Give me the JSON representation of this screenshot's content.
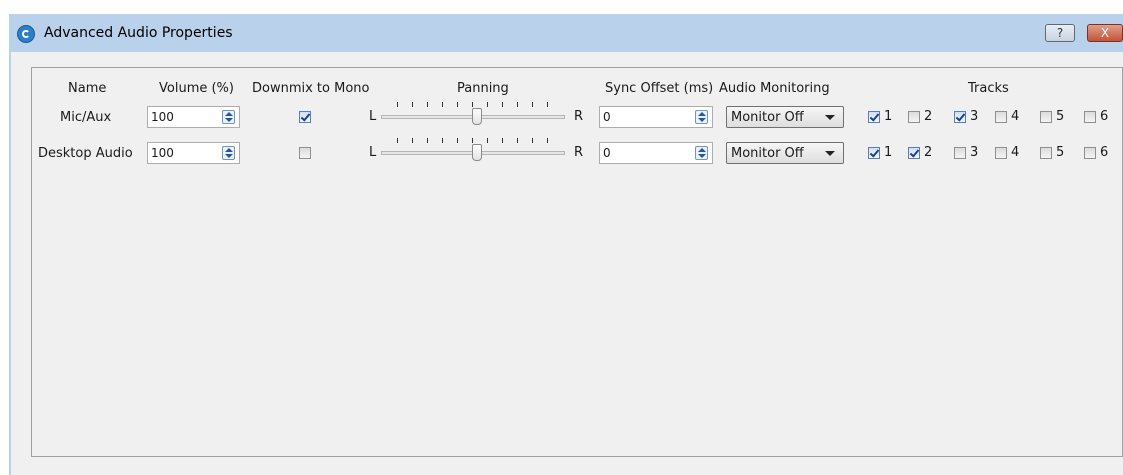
{
  "window": {
    "title": "Advanced Audio Properties",
    "help_label": "?",
    "close_label": "X"
  },
  "headers": {
    "name": "Name",
    "volume": "Volume (%)",
    "downmix": "Downmix to Mono",
    "panning": "Panning",
    "sync_offset": "Sync Offset (ms)",
    "monitoring": "Audio Monitoring",
    "tracks": "Tracks"
  },
  "rows": [
    {
      "name": "Mic/Aux",
      "volume": "100",
      "downmix": true,
      "pan_left": "L",
      "pan_right": "R",
      "pan_value": 0.5,
      "sync_offset": "0",
      "monitoring": "Monitor Off",
      "tracks": [
        {
          "label": "1",
          "checked": true
        },
        {
          "label": "2",
          "checked": false
        },
        {
          "label": "3",
          "checked": true
        },
        {
          "label": "4",
          "checked": false
        },
        {
          "label": "5",
          "checked": false
        },
        {
          "label": "6",
          "checked": false
        }
      ]
    },
    {
      "name": "Desktop Audio",
      "volume": "100",
      "downmix": false,
      "pan_left": "L",
      "pan_right": "R",
      "pan_value": 0.5,
      "sync_offset": "0",
      "monitoring": "Monitor Off",
      "tracks": [
        {
          "label": "1",
          "checked": true
        },
        {
          "label": "2",
          "checked": true
        },
        {
          "label": "3",
          "checked": false
        },
        {
          "label": "4",
          "checked": false
        },
        {
          "label": "5",
          "checked": false
        },
        {
          "label": "6",
          "checked": false
        }
      ]
    }
  ],
  "icons": {
    "app": "obs-logo-icon",
    "help": "help-icon",
    "close": "close-icon",
    "spin": "spin-arrows-icon",
    "dropdown": "chevron-down-icon"
  },
  "colors": {
    "titlebar": "#b9d1ea",
    "client": "#f0f0f0",
    "close_button": "#c25437"
  }
}
